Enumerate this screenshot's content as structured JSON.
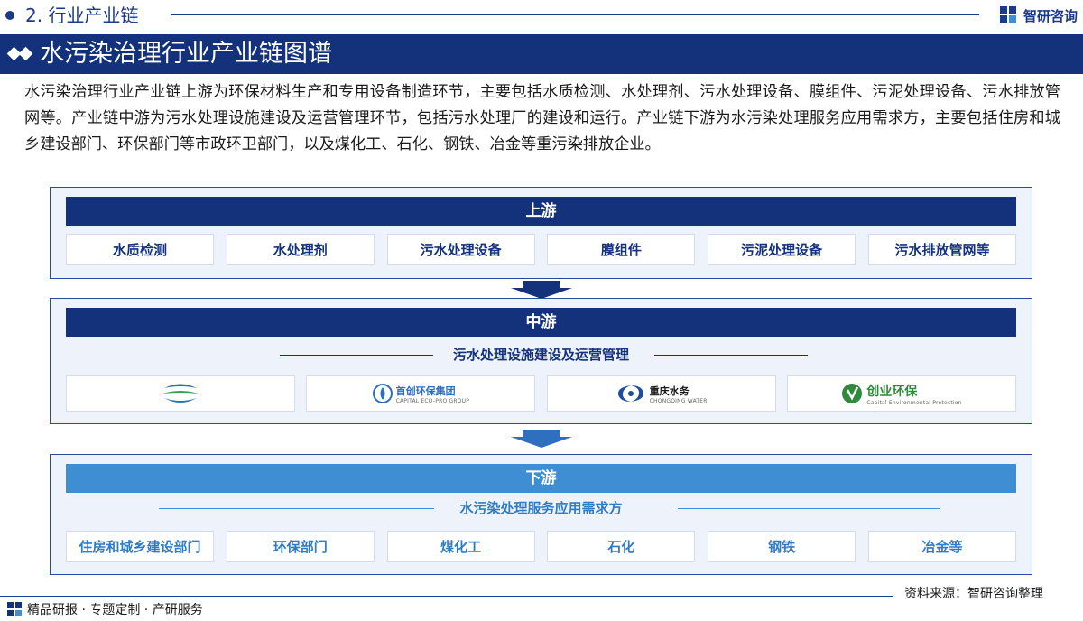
{
  "header": {
    "section": "2. 行业产业链",
    "brand": "智研咨询",
    "title": "水污染治理行业产业链图谱"
  },
  "intro": "水污染治理行业产业链上游为环保材料生产和专用设备制造环节，主要包括水质检测、水处理剂、污水处理设备、膜组件、污泥处理设备、污水排放管网等。产业链中游为污水处理设施建设及运营管理环节，包括污水处理厂的建设和运行。产业链下游为水污染处理服务应用需求方，主要包括住房和城乡建设部门、环保部门等市政环卫部门，以及煤化工、石化、钢铁、冶金等重污染排放企业。",
  "upstream": {
    "label": "上游",
    "items": [
      "水质检测",
      "水处理剂",
      "污水处理设备",
      "膜组件",
      "污泥处理设备",
      "污水排放管网等"
    ]
  },
  "midstream": {
    "label": "中游",
    "subtitle": "污水处理设施建设及运营管理",
    "companies": [
      {
        "name": "",
        "sub": ""
      },
      {
        "name": "首创环保集团",
        "sub": "CAPITAL ECO-PRO GROUP"
      },
      {
        "name": "重庆水务",
        "sub": "CHONGQING WATER"
      },
      {
        "name": "创业环保",
        "sub": "Capital Environmental Protection"
      }
    ]
  },
  "downstream": {
    "label": "下游",
    "subtitle": "水污染处理服务应用需求方",
    "items": [
      "住房和城乡建设部门",
      "环保部门",
      "煤化工",
      "石化",
      "钢铁",
      "冶金等"
    ]
  },
  "footer": {
    "source": "资料来源：智研咨询整理",
    "slogan": "精品研报 · 专题定制 · 产研服务"
  },
  "colors": {
    "navy": "#14327c",
    "light_blue": "#3f8ed4",
    "panel_bg": "#eef2fa"
  }
}
